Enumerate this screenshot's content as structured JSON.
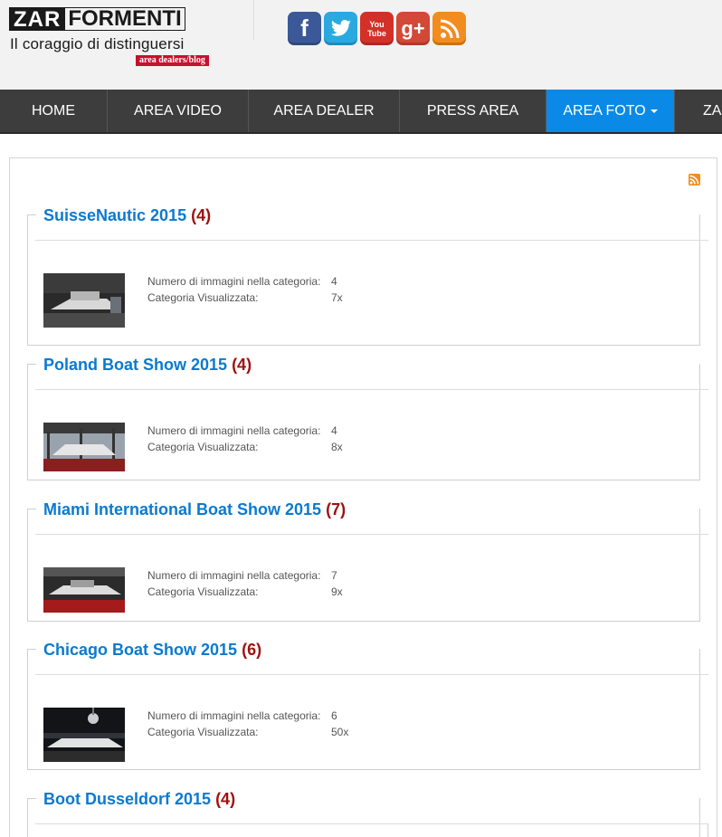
{
  "logo": {
    "brand_a": "ZAR",
    "brand_b": "FORMENTI",
    "slogan": "Il coraggio di distinguersi",
    "badge": "area dealers/blog"
  },
  "social": {
    "facebook": "f",
    "youtube_line1": "You",
    "youtube_line2": "Tube",
    "googleplus": "g+"
  },
  "nav": {
    "items": [
      {
        "label": "HOME"
      },
      {
        "label": "AREA VIDEO"
      },
      {
        "label": "AREA DEALER"
      },
      {
        "label": "PRESS AREA"
      },
      {
        "label": "AREA FOTO"
      },
      {
        "label": "ZA"
      }
    ],
    "active_color": "#0a8ae6",
    "bar_color": "#3d3d3d"
  },
  "labels": {
    "images_in_category": "Numero di immagini nella categoria:",
    "category_viewed": "Categoria Visualizzata:"
  },
  "categories": [
    {
      "title": "SuisseNautic 2015",
      "count": "(4)",
      "images": "4",
      "viewed": "7x"
    },
    {
      "title": "Poland Boat Show 2015",
      "count": "(4)",
      "images": "4",
      "viewed": "8x"
    },
    {
      "title": "Miami International Boat Show 2015",
      "count": "(7)",
      "images": "7",
      "viewed": "9x"
    },
    {
      "title": "Chicago Boat Show 2015",
      "count": "(6)",
      "images": "6",
      "viewed": "50x"
    },
    {
      "title": "Boot Dusseldorf 2015",
      "count": "(4)"
    }
  ],
  "colors": {
    "title": "#0a7ad0",
    "count": "#a01010"
  }
}
